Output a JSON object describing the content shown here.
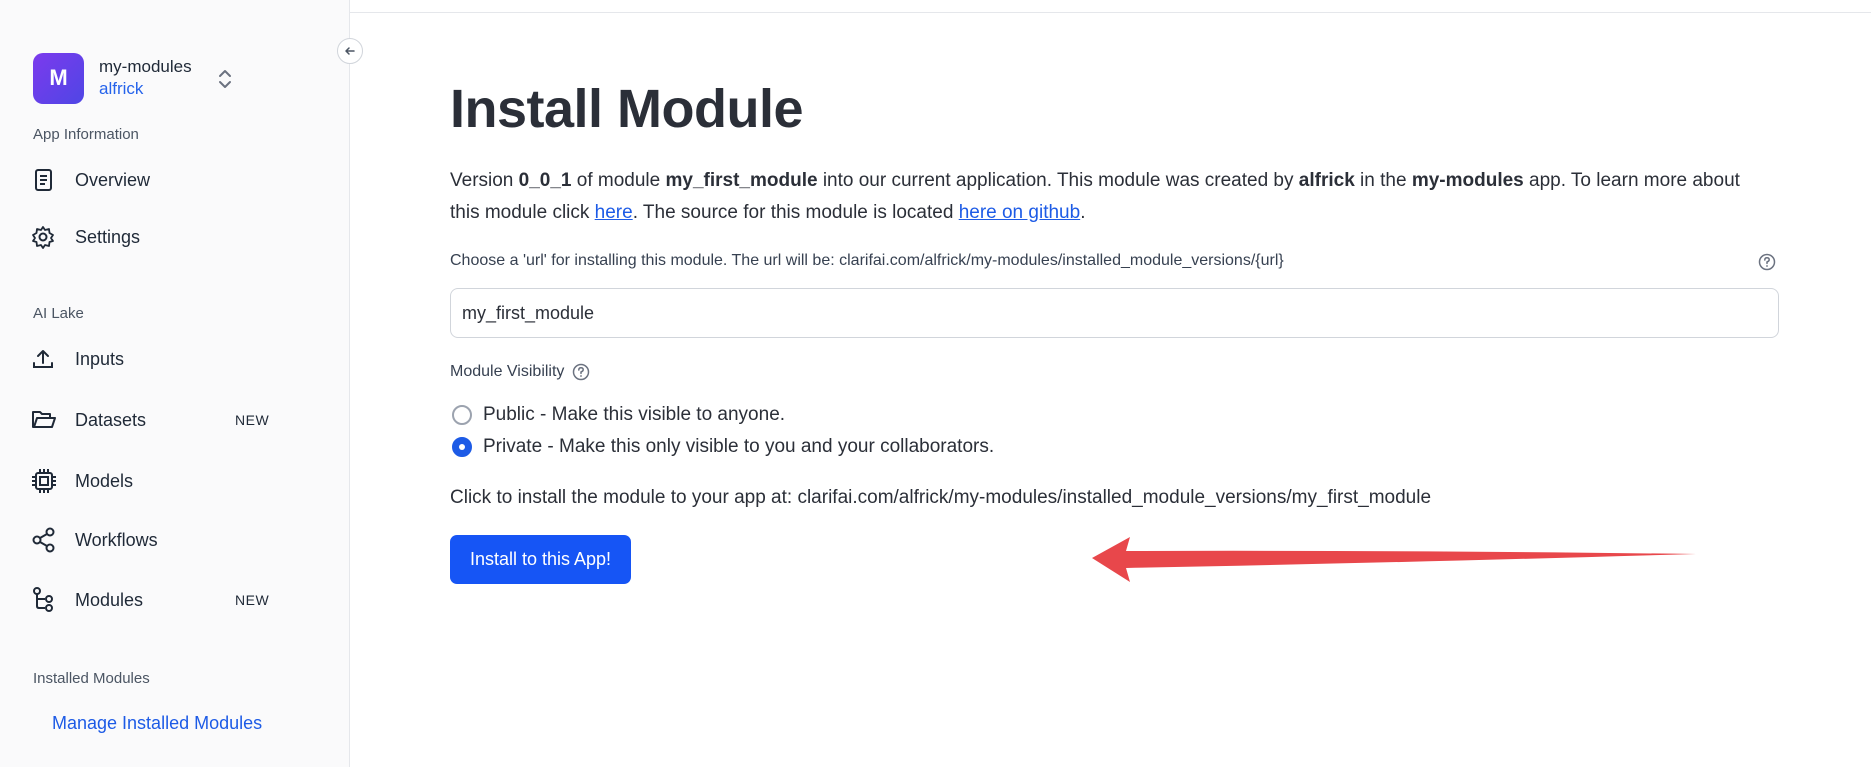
{
  "sidebar": {
    "app": {
      "avatar_letter": "M",
      "name": "my-modules",
      "owner": "alfrick"
    },
    "sections": {
      "app_information": "App Information",
      "ai_lake": "AI Lake",
      "installed_modules": "Installed Modules"
    },
    "items": [
      {
        "label": "Overview",
        "icon": "document-icon"
      },
      {
        "label": "Settings",
        "icon": "gear-icon"
      },
      {
        "label": "Inputs",
        "icon": "upload-icon"
      },
      {
        "label": "Datasets",
        "icon": "folder-icon",
        "badge": "NEW"
      },
      {
        "label": "Models",
        "icon": "chip-icon"
      },
      {
        "label": "Workflows",
        "icon": "share-nodes-icon"
      },
      {
        "label": "Modules",
        "icon": "modules-tree-icon",
        "badge": "NEW"
      }
    ],
    "manage_link": "Manage Installed Modules"
  },
  "main": {
    "title": "Install Module",
    "intro": {
      "t1": "Version ",
      "version": "0_0_1",
      "t2": " of module ",
      "module": "my_first_module",
      "t3": " into our current application. This module was created by ",
      "creator": "alfrick",
      "t4": " in the ",
      "app": "my-modules",
      "t5": " app. To learn more about this module click ",
      "here": "here",
      "t6": ". The source for this module is located ",
      "github": "here on github",
      "t7": "."
    },
    "url_label": "Choose a 'url' for installing this module. The url will be: clarifai.com/alfrick/my-modules/installed_module_versions/{url}",
    "url_value": "my_first_module",
    "visibility_label": "Module Visibility",
    "visibility_options": [
      {
        "label": "Public - Make this visible to anyone.",
        "checked": false
      },
      {
        "label": "Private - Make this only visible to you and your collaborators.",
        "checked": true
      }
    ],
    "install_info": "Click to install the module to your app at: clarifai.com/alfrick/my-modules/installed_module_versions/my_first_module",
    "install_button": "Install to this App!"
  },
  "colors": {
    "accent": "#1655f5",
    "link": "#1d5be6",
    "annotation_arrow": "#e8474b"
  }
}
